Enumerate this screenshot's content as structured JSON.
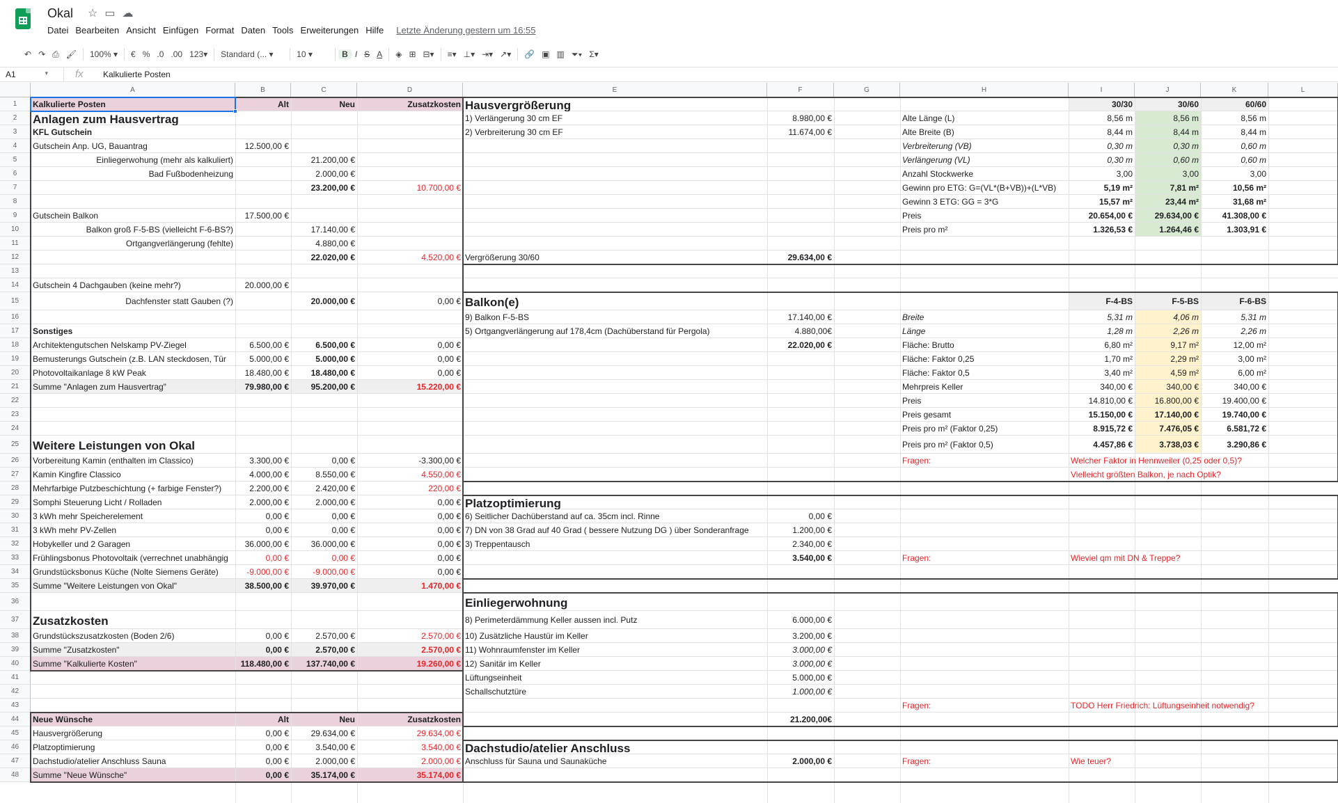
{
  "app": {
    "title": "Okal",
    "star_icon": "star",
    "move_icon": "folder",
    "cloud_icon": "cloud"
  },
  "menu": [
    "Datei",
    "Bearbeiten",
    "Ansicht",
    "Einfügen",
    "Format",
    "Daten",
    "Tools",
    "Erweiterungen",
    "Hilfe"
  ],
  "last_edit": "Letzte Änderung gestern um 16:55",
  "toolbar": {
    "zoom": "100%",
    "currency": "€",
    "percent": "%",
    "dec_less": ".0",
    "dec_more": ".00",
    "more_formats": "123",
    "font": "Standard (...",
    "size": "10"
  },
  "namebox": "A1",
  "formula": "Kalkulierte Posten",
  "columns": [
    "A",
    "B",
    "C",
    "D",
    "E",
    "F",
    "G",
    "H",
    "I",
    "J",
    "K",
    "L"
  ],
  "cells": [
    {
      "id": "A1",
      "t": "Kalkulierte Posten",
      "s": "b"
    },
    {
      "id": "B1",
      "t": "Alt",
      "s": "b r"
    },
    {
      "id": "C1",
      "t": "Neu",
      "s": "b r"
    },
    {
      "id": "D1",
      "t": "Zusatzkosten",
      "s": "b r"
    },
    {
      "id": "E1",
      "t": "Hausvergrößerung",
      "s": "h"
    },
    {
      "id": "I1",
      "t": "30/30",
      "s": "b r"
    },
    {
      "id": "J1",
      "t": "30/60",
      "s": "b r"
    },
    {
      "id": "K1",
      "t": "60/60",
      "s": "b r"
    },
    {
      "id": "A2",
      "t": "Anlagen zum Hausvertrag",
      "s": "h"
    },
    {
      "id": "E2",
      "t": "1) Verlängerung 30 cm EF"
    },
    {
      "id": "F2",
      "t": "8.980,00 €",
      "s": "r"
    },
    {
      "id": "H2",
      "t": "Alte Länge (L)"
    },
    {
      "id": "I2",
      "t": "8,56 m",
      "s": "r"
    },
    {
      "id": "J2",
      "t": "8,56 m",
      "s": "r"
    },
    {
      "id": "K2",
      "t": "8,56 m",
      "s": "r"
    },
    {
      "id": "A3",
      "t": "KFL Gutschein",
      "s": "b"
    },
    {
      "id": "E3",
      "t": "2) Verbreiterung 30 cm EF"
    },
    {
      "id": "F3",
      "t": "11.674,00 €",
      "s": "r"
    },
    {
      "id": "H3",
      "t": "Alte Breite (B)"
    },
    {
      "id": "I3",
      "t": "8,44 m",
      "s": "r"
    },
    {
      "id": "J3",
      "t": "8,44 m",
      "s": "r"
    },
    {
      "id": "K3",
      "t": "8,44 m",
      "s": "r"
    },
    {
      "id": "A4",
      "t": "Gutschein Anp. UG, Bauantrag"
    },
    {
      "id": "B4",
      "t": "12.500,00 €",
      "s": "r"
    },
    {
      "id": "H4",
      "t": "Verbreiterung (VB)",
      "s": "it"
    },
    {
      "id": "I4",
      "t": "0,30 m",
      "s": "r it"
    },
    {
      "id": "J4",
      "t": "0,30 m",
      "s": "r it"
    },
    {
      "id": "K4",
      "t": "0,60 m",
      "s": "r it"
    },
    {
      "id": "A5",
      "t": "Einliegerwohung (mehr als kalkuliert)",
      "s": "r"
    },
    {
      "id": "C5",
      "t": "21.200,00 €",
      "s": "r"
    },
    {
      "id": "H5",
      "t": "Verlängerung (VL)",
      "s": "it"
    },
    {
      "id": "I5",
      "t": "0,30 m",
      "s": "r it"
    },
    {
      "id": "J5",
      "t": "0,60 m",
      "s": "r it"
    },
    {
      "id": "K5",
      "t": "0,60 m",
      "s": "r it"
    },
    {
      "id": "A6",
      "t": "Bad Fußbodenheizung",
      "s": "r"
    },
    {
      "id": "C6",
      "t": "2.000,00 €",
      "s": "r"
    },
    {
      "id": "H6",
      "t": "Anzahl Stockwerke"
    },
    {
      "id": "I6",
      "t": "3,00",
      "s": "r"
    },
    {
      "id": "J6",
      "t": "3,00",
      "s": "r"
    },
    {
      "id": "K6",
      "t": "3,00",
      "s": "r"
    },
    {
      "id": "C7",
      "t": "23.200,00 €",
      "s": "r b"
    },
    {
      "id": "D7",
      "t": "10.700,00 €",
      "s": "r red"
    },
    {
      "id": "H7",
      "t": "Gewinn pro ETG: G=(VL*(B+VB))+(L*VB)"
    },
    {
      "id": "I7",
      "t": "5,19 m²",
      "s": "r b"
    },
    {
      "id": "J7",
      "t": "7,81 m²",
      "s": "r b"
    },
    {
      "id": "K7",
      "t": "10,56 m²",
      "s": "r b"
    },
    {
      "id": "H8",
      "t": "Gewinn 3 ETG: GG = 3*G"
    },
    {
      "id": "I8",
      "t": "15,57 m²",
      "s": "r b"
    },
    {
      "id": "J8",
      "t": "23,44 m²",
      "s": "r b"
    },
    {
      "id": "K8",
      "t": "31,68 m²",
      "s": "r b"
    },
    {
      "id": "A9",
      "t": "Gutschein Balkon"
    },
    {
      "id": "B9",
      "t": "17.500,00 €",
      "s": "r"
    },
    {
      "id": "H9",
      "t": "Preis"
    },
    {
      "id": "I9",
      "t": "20.654,00 €",
      "s": "r b"
    },
    {
      "id": "J9",
      "t": "29.634,00 €",
      "s": "r b"
    },
    {
      "id": "K9",
      "t": "41.308,00 €",
      "s": "r b"
    },
    {
      "id": "A10",
      "t": "Balkon groß F-5-BS (vielleicht F-6-BS?)",
      "s": "r"
    },
    {
      "id": "C10",
      "t": "17.140,00 €",
      "s": "r"
    },
    {
      "id": "H10",
      "t": "Preis pro m²"
    },
    {
      "id": "I10",
      "t": "1.326,53 €",
      "s": "r b"
    },
    {
      "id": "J10",
      "t": "1.264,46 €",
      "s": "r b"
    },
    {
      "id": "K10",
      "t": "1.303,91 €",
      "s": "r b"
    },
    {
      "id": "A11",
      "t": "Ortgangverlängerung (fehlte)",
      "s": "r"
    },
    {
      "id": "C11",
      "t": "4.880,00 €",
      "s": "r"
    },
    {
      "id": "C12",
      "t": "22.020,00 €",
      "s": "r b"
    },
    {
      "id": "D12",
      "t": "4.520,00 €",
      "s": "r red"
    },
    {
      "id": "E12",
      "t": "Vergrößerung 30/60"
    },
    {
      "id": "F12",
      "t": "29.634,00 €",
      "s": "r b"
    },
    {
      "id": "A14",
      "t": "Gutschein 4 Dachgauben (keine mehr?)"
    },
    {
      "id": "B14",
      "t": "20.000,00 €",
      "s": "r"
    },
    {
      "id": "A15",
      "t": "Dachfenster statt Gauben (?)",
      "s": "r"
    },
    {
      "id": "C15",
      "t": "20.000,00 €",
      "s": "r b"
    },
    {
      "id": "D15",
      "t": "0,00 €",
      "s": "r"
    },
    {
      "id": "E15",
      "t": "Balkon(e)",
      "s": "h"
    },
    {
      "id": "I15",
      "t": "F-4-BS",
      "s": "b r"
    },
    {
      "id": "J15",
      "t": "F-5-BS",
      "s": "b r"
    },
    {
      "id": "K15",
      "t": "F-6-BS",
      "s": "b r"
    },
    {
      "id": "E16",
      "t": "9) Balkon F-5-BS"
    },
    {
      "id": "F16",
      "t": "17.140,00 €",
      "s": "r"
    },
    {
      "id": "H16",
      "t": "Breite",
      "s": "it"
    },
    {
      "id": "I16",
      "t": "5,31 m",
      "s": "r it"
    },
    {
      "id": "J16",
      "t": "4,06 m",
      "s": "r it"
    },
    {
      "id": "K16",
      "t": "5,31 m",
      "s": "r it"
    },
    {
      "id": "A17",
      "t": "Sonstiges",
      "s": "b"
    },
    {
      "id": "E17",
      "t": "5) Ortgangverlängerung auf 178,4cm (Dachüberstand für Pergola)"
    },
    {
      "id": "F17",
      "t": "4.880,00€",
      "s": "r"
    },
    {
      "id": "H17",
      "t": "Länge",
      "s": "it"
    },
    {
      "id": "I17",
      "t": "1,28 m",
      "s": "r it"
    },
    {
      "id": "J17",
      "t": "2,26 m",
      "s": "r it"
    },
    {
      "id": "K17",
      "t": "2,26 m",
      "s": "r it"
    },
    {
      "id": "A18",
      "t": "Architektengutschen Nelskamp PV-Ziegel"
    },
    {
      "id": "B18",
      "t": "6.500,00 €",
      "s": "r"
    },
    {
      "id": "C18",
      "t": "6.500,00 €",
      "s": "r b"
    },
    {
      "id": "D18",
      "t": "0,00 €",
      "s": "r"
    },
    {
      "id": "F18",
      "t": "22.020,00 €",
      "s": "r b"
    },
    {
      "id": "H18",
      "t": "Fläche: Brutto"
    },
    {
      "id": "I18",
      "t": "6,80 m²",
      "s": "r"
    },
    {
      "id": "J18",
      "t": "9,17 m²",
      "s": "r"
    },
    {
      "id": "K18",
      "t": "12,00 m²",
      "s": "r"
    },
    {
      "id": "A19",
      "t": "Bemusterungs Gutschein (z.B. LAN steckdosen, Tür"
    },
    {
      "id": "B19",
      "t": "5.000,00 €",
      "s": "r"
    },
    {
      "id": "C19",
      "t": "5.000,00 €",
      "s": "r b"
    },
    {
      "id": "D19",
      "t": "0,00 €",
      "s": "r"
    },
    {
      "id": "H19",
      "t": "Fläche: Faktor 0,25"
    },
    {
      "id": "I19",
      "t": "1,70 m²",
      "s": "r"
    },
    {
      "id": "J19",
      "t": "2,29 m²",
      "s": "r"
    },
    {
      "id": "K19",
      "t": "3,00 m²",
      "s": "r"
    },
    {
      "id": "A20",
      "t": "Photovoltaikanlage 8 kW Peak"
    },
    {
      "id": "B20",
      "t": "18.480,00 €",
      "s": "r"
    },
    {
      "id": "C20",
      "t": "18.480,00 €",
      "s": "r b"
    },
    {
      "id": "D20",
      "t": "0,00 €",
      "s": "r"
    },
    {
      "id": "H20",
      "t": "Fläche: Faktor 0,5"
    },
    {
      "id": "I20",
      "t": "3,40 m²",
      "s": "r"
    },
    {
      "id": "J20",
      "t": "4,59 m²",
      "s": "r"
    },
    {
      "id": "K20",
      "t": "6,00 m²",
      "s": "r"
    },
    {
      "id": "A21",
      "t": "Summe \"Anlagen zum Hausvertrag\""
    },
    {
      "id": "B21",
      "t": "79.980,00 €",
      "s": "r b"
    },
    {
      "id": "C21",
      "t": "95.200,00 €",
      "s": "r b"
    },
    {
      "id": "D21",
      "t": "15.220,00 €",
      "s": "r b red"
    },
    {
      "id": "H21",
      "t": "Mehrpreis Keller"
    },
    {
      "id": "I21",
      "t": "340,00 €",
      "s": "r"
    },
    {
      "id": "J21",
      "t": "340,00 €",
      "s": "r"
    },
    {
      "id": "K21",
      "t": "340,00 €",
      "s": "r"
    },
    {
      "id": "H22",
      "t": "Preis"
    },
    {
      "id": "I22",
      "t": "14.810,00 €",
      "s": "r"
    },
    {
      "id": "J22",
      "t": "16.800,00 €",
      "s": "r"
    },
    {
      "id": "K22",
      "t": "19.400,00 €",
      "s": "r"
    },
    {
      "id": "H23",
      "t": "Preis gesamt"
    },
    {
      "id": "I23",
      "t": "15.150,00 €",
      "s": "r b"
    },
    {
      "id": "J23",
      "t": "17.140,00 €",
      "s": "r b"
    },
    {
      "id": "K23",
      "t": "19.740,00 €",
      "s": "r b"
    },
    {
      "id": "H24",
      "t": "Preis pro m² (Faktor 0,25)"
    },
    {
      "id": "I24",
      "t": "8.915,72 €",
      "s": "r b"
    },
    {
      "id": "J24",
      "t": "7.476,05 €",
      "s": "r b"
    },
    {
      "id": "K24",
      "t": "6.581,72 €",
      "s": "r b"
    },
    {
      "id": "A25",
      "t": "Weitere Leistungen von Okal",
      "s": "h"
    },
    {
      "id": "H25",
      "t": "Preis pro m² (Faktor 0,5)"
    },
    {
      "id": "I25",
      "t": "4.457,86 €",
      "s": "r b"
    },
    {
      "id": "J25",
      "t": "3.738,03 €",
      "s": "r b"
    },
    {
      "id": "K25",
      "t": "3.290,86 €",
      "s": "r b"
    },
    {
      "id": "A26",
      "t": "Vorbereitung Kamin (enthalten im Classico)"
    },
    {
      "id": "B26",
      "t": "3.300,00 €",
      "s": "r"
    },
    {
      "id": "C26",
      "t": "0,00 €",
      "s": "r"
    },
    {
      "id": "D26",
      "t": "-3.300,00 €",
      "s": "r"
    },
    {
      "id": "H26",
      "t": "Fragen:",
      "s": "red"
    },
    {
      "id": "I26",
      "t": "Welcher Faktor in Hennweiler (0,25 oder 0,5)?",
      "s": "red"
    },
    {
      "id": "A27",
      "t": "Kamin Kingfire Classico"
    },
    {
      "id": "B27",
      "t": "4.000,00 €",
      "s": "r"
    },
    {
      "id": "C27",
      "t": "8.550,00 €",
      "s": "r"
    },
    {
      "id": "D27",
      "t": "4.550,00 €",
      "s": "r red"
    },
    {
      "id": "I27",
      "t": "Vielleicht größten Balkon, je nach Optik?",
      "s": "red"
    },
    {
      "id": "A28",
      "t": "Mehrfarbige Putzbeschichtung (+ farbige Fenster?)"
    },
    {
      "id": "B28",
      "t": "2.200,00 €",
      "s": "r"
    },
    {
      "id": "C28",
      "t": "2.420,00 €",
      "s": "r"
    },
    {
      "id": "D28",
      "t": "220,00 €",
      "s": "r red"
    },
    {
      "id": "A29",
      "t": "Somphi Steuerung Licht / Rolladen"
    },
    {
      "id": "B29",
      "t": "2.000,00 €",
      "s": "r"
    },
    {
      "id": "C29",
      "t": "2.000,00 €",
      "s": "r"
    },
    {
      "id": "D29",
      "t": "0,00 €",
      "s": "r"
    },
    {
      "id": "E29",
      "t": "Platzoptimierung",
      "s": "h"
    },
    {
      "id": "A30",
      "t": "3 kWh mehr Speicherelement"
    },
    {
      "id": "B30",
      "t": "0,00 €",
      "s": "r"
    },
    {
      "id": "C30",
      "t": "0,00 €",
      "s": "r"
    },
    {
      "id": "D30",
      "t": "0,00 €",
      "s": "r"
    },
    {
      "id": "E30",
      "t": "6) Seitlicher Dachüberstand auf ca. 35cm incl. Rinne"
    },
    {
      "id": "F30",
      "t": "0,00 €",
      "s": "r"
    },
    {
      "id": "A31",
      "t": "3 kWh mehr PV-Zellen"
    },
    {
      "id": "B31",
      "t": "0,00 €",
      "s": "r"
    },
    {
      "id": "C31",
      "t": "0,00 €",
      "s": "r"
    },
    {
      "id": "D31",
      "t": "0,00 €",
      "s": "r"
    },
    {
      "id": "E31",
      "t": "7) DN von 38 Grad auf 40 Grad ( bessere Nutzung DG ) über Sonderanfrage"
    },
    {
      "id": "F31",
      "t": "1.200,00 €",
      "s": "r"
    },
    {
      "id": "A32",
      "t": "Hobykeller und 2 Garagen"
    },
    {
      "id": "B32",
      "t": "36.000,00 €",
      "s": "r"
    },
    {
      "id": "C32",
      "t": "36.000,00 €",
      "s": "r"
    },
    {
      "id": "D32",
      "t": "0,00 €",
      "s": "r"
    },
    {
      "id": "E32",
      "t": "3) Treppentausch"
    },
    {
      "id": "F32",
      "t": "2.340,00 €",
      "s": "r"
    },
    {
      "id": "A33",
      "t": "Frühlingsbonus Photovoltaik (verrechnet unabhängig"
    },
    {
      "id": "B33",
      "t": "0,00 €",
      "s": "r red"
    },
    {
      "id": "C33",
      "t": "0,00 €",
      "s": "r red"
    },
    {
      "id": "D33",
      "t": "0,00 €",
      "s": "r"
    },
    {
      "id": "F33",
      "t": "3.540,00 €",
      "s": "r b"
    },
    {
      "id": "H33",
      "t": "Fragen:",
      "s": "red"
    },
    {
      "id": "I33",
      "t": "Wieviel qm mit DN & Treppe?",
      "s": "red"
    },
    {
      "id": "A34",
      "t": "Grundstücksbonus Küche (Nolte Siemens Geräte)"
    },
    {
      "id": "B34",
      "t": "-9.000,00 €",
      "s": "r red"
    },
    {
      "id": "C34",
      "t": "-9.000,00 €",
      "s": "r red"
    },
    {
      "id": "D34",
      "t": "0,00 €",
      "s": "r"
    },
    {
      "id": "A35",
      "t": "Summe \"Weitere Leistungen von Okal\""
    },
    {
      "id": "B35",
      "t": "38.500,00 €",
      "s": "r b"
    },
    {
      "id": "C35",
      "t": "39.970,00 €",
      "s": "r b"
    },
    {
      "id": "D35",
      "t": "1.470,00 €",
      "s": "r b red"
    },
    {
      "id": "E36",
      "t": "Einliegerwohnung",
      "s": "h"
    },
    {
      "id": "A37",
      "t": "Zusatzkosten",
      "s": "h"
    },
    {
      "id": "E37",
      "t": "8) Perimeterdämmung Keller aussen incl. Putz"
    },
    {
      "id": "F37",
      "t": "6.000,00 €",
      "s": "r"
    },
    {
      "id": "A38",
      "t": "Grundstückszusatzkosten (Boden 2/6)"
    },
    {
      "id": "B38",
      "t": "0,00 €",
      "s": "r"
    },
    {
      "id": "C38",
      "t": "2.570,00 €",
      "s": "r"
    },
    {
      "id": "D38",
      "t": "2.570,00 €",
      "s": "r red"
    },
    {
      "id": "E38",
      "t": "10) Zusätzliche Haustür im Keller"
    },
    {
      "id": "F38",
      "t": "3.200,00 €",
      "s": "r"
    },
    {
      "id": "A39",
      "t": "Summe \"Zusatzkosten\""
    },
    {
      "id": "B39",
      "t": "0,00 €",
      "s": "r b"
    },
    {
      "id": "C39",
      "t": "2.570,00 €",
      "s": "r b"
    },
    {
      "id": "D39",
      "t": "2.570,00 €",
      "s": "r b red"
    },
    {
      "id": "E39",
      "t": "11) Wohnraumfenster im Keller"
    },
    {
      "id": "F39",
      "t": "3.000,00 €",
      "s": "r it"
    },
    {
      "id": "A40",
      "t": "Summe \"Kalkulierte Kosten\""
    },
    {
      "id": "B40",
      "t": "118.480,00 €",
      "s": "r b"
    },
    {
      "id": "C40",
      "t": "137.740,00 €",
      "s": "r b"
    },
    {
      "id": "D40",
      "t": "19.260,00 €",
      "s": "r b red"
    },
    {
      "id": "E40",
      "t": "12) Sanitär im Keller"
    },
    {
      "id": "F40",
      "t": "3.000,00 €",
      "s": "r it"
    },
    {
      "id": "E41",
      "t": "Lüftungseinheit"
    },
    {
      "id": "F41",
      "t": "5.000,00 €",
      "s": "r"
    },
    {
      "id": "E42",
      "t": "Schallschutztüre"
    },
    {
      "id": "F42",
      "t": "1.000,00 €",
      "s": "r it"
    },
    {
      "id": "H43",
      "t": "Fragen:",
      "s": "red"
    },
    {
      "id": "I43",
      "t": "TODO Herr Friedrich: Lüftungseinheit notwendig?",
      "s": "red"
    },
    {
      "id": "A44",
      "t": "Neue Wünsche",
      "s": "b"
    },
    {
      "id": "B44",
      "t": "Alt",
      "s": "b r"
    },
    {
      "id": "C44",
      "t": "Neu",
      "s": "b r"
    },
    {
      "id": "D44",
      "t": "Zusatzkosten",
      "s": "b r"
    },
    {
      "id": "F44",
      "t": "21.200,00€",
      "s": "r b"
    },
    {
      "id": "A45",
      "t": "Hausvergrößerung"
    },
    {
      "id": "B45",
      "t": "0,00 €",
      "s": "r"
    },
    {
      "id": "C45",
      "t": "29.634,00 €",
      "s": "r"
    },
    {
      "id": "D45",
      "t": "29.634,00 €",
      "s": "r red"
    },
    {
      "id": "A46",
      "t": "Platzoptimierung"
    },
    {
      "id": "B46",
      "t": "0,00 €",
      "s": "r"
    },
    {
      "id": "C46",
      "t": "3.540,00 €",
      "s": "r"
    },
    {
      "id": "D46",
      "t": "3.540,00 €",
      "s": "r red"
    },
    {
      "id": "E46",
      "t": "Dachstudio/atelier Anschluss",
      "s": "h"
    },
    {
      "id": "A47",
      "t": "Dachstudio/atelier Anschluss Sauna"
    },
    {
      "id": "B47",
      "t": "0,00 €",
      "s": "r"
    },
    {
      "id": "C47",
      "t": "2.000,00 €",
      "s": "r"
    },
    {
      "id": "D47",
      "t": "2.000,00 €",
      "s": "r red"
    },
    {
      "id": "E47",
      "t": "Anschluss für Sauna und Saunaküche"
    },
    {
      "id": "F47",
      "t": "2.000,00 €",
      "s": "r b"
    },
    {
      "id": "H47",
      "t": "Fragen:",
      "s": "red"
    },
    {
      "id": "I47",
      "t": "Wie teuer?",
      "s": "red"
    },
    {
      "id": "A48",
      "t": "Summe \"Neue Wünsche\""
    },
    {
      "id": "B48",
      "t": "0,00 €",
      "s": "r b"
    },
    {
      "id": "C48",
      "t": "35.174,00 €",
      "s": "r b"
    },
    {
      "id": "D48",
      "t": "35.174,00 €",
      "s": "r b red"
    }
  ],
  "colors": {
    "pink": "#ead1dc",
    "green": "#d9ead3",
    "yellow": "#fff2cc",
    "gray": "#efefef",
    "red": "#e8262a",
    "select": "#1a73e8",
    "logo": "#0f9d58"
  }
}
